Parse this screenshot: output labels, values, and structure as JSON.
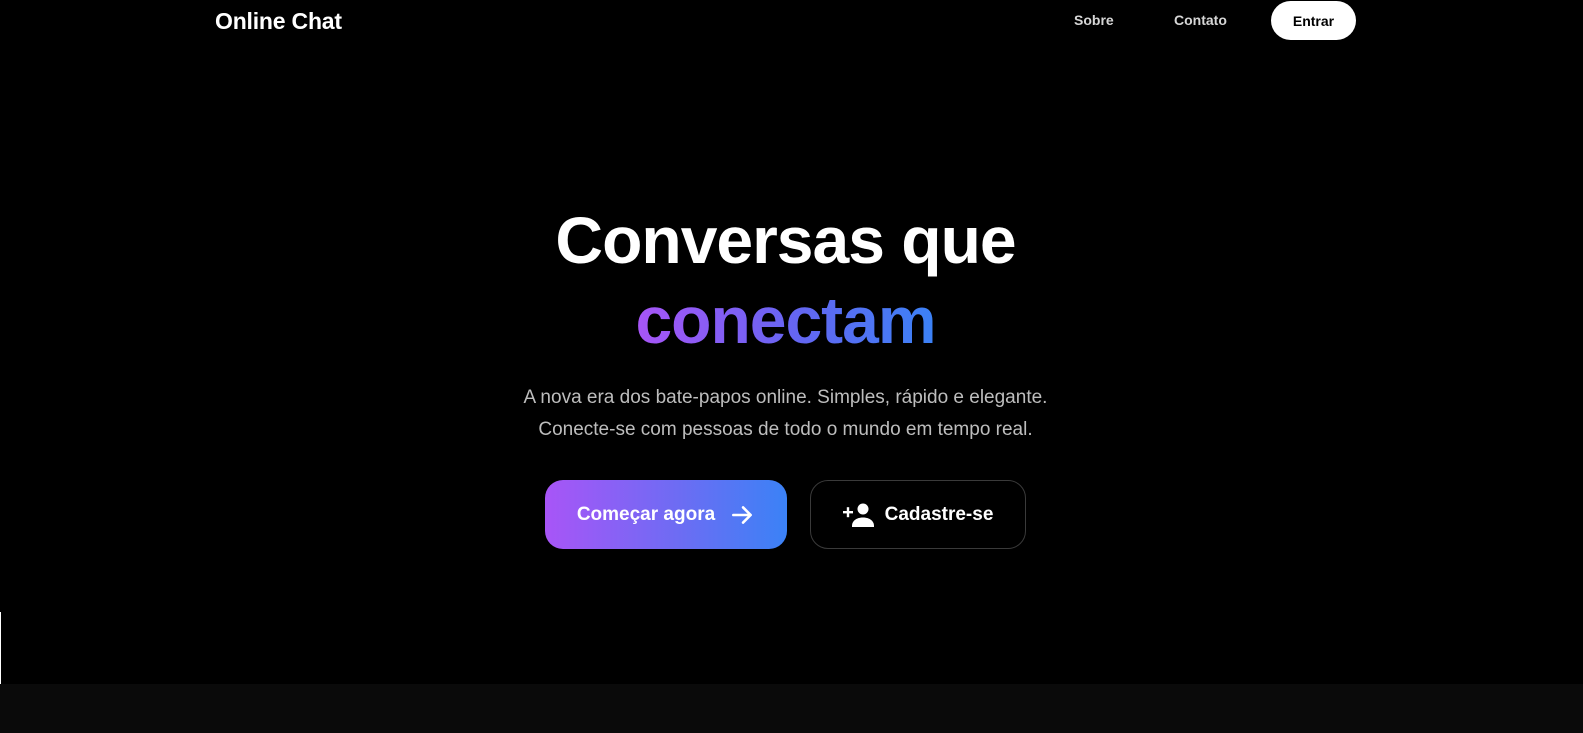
{
  "nav": {
    "brand": "Online Chat",
    "links": [
      "Sobre",
      "Contato"
    ],
    "login_label": "Entrar"
  },
  "hero": {
    "title_line1": "Conversas que",
    "title_line2": "conectam",
    "subtitle_line1": "A nova era dos bate-papos online. Simples, rápido e elegante.",
    "subtitle_line2": "Conecte-se com pessoas de todo o mundo em tempo real."
  },
  "cta": {
    "primary_label": "Começar agora",
    "primary_icon": "arrow-right-icon",
    "secondary_label": "Cadastre-se",
    "secondary_icon": "add-user-icon"
  },
  "colors": {
    "background": "#000000",
    "gradient_start": "#a855f7",
    "gradient_end": "#3b82f6",
    "text_primary": "#ffffff",
    "text_muted": "#bdbdbd"
  }
}
